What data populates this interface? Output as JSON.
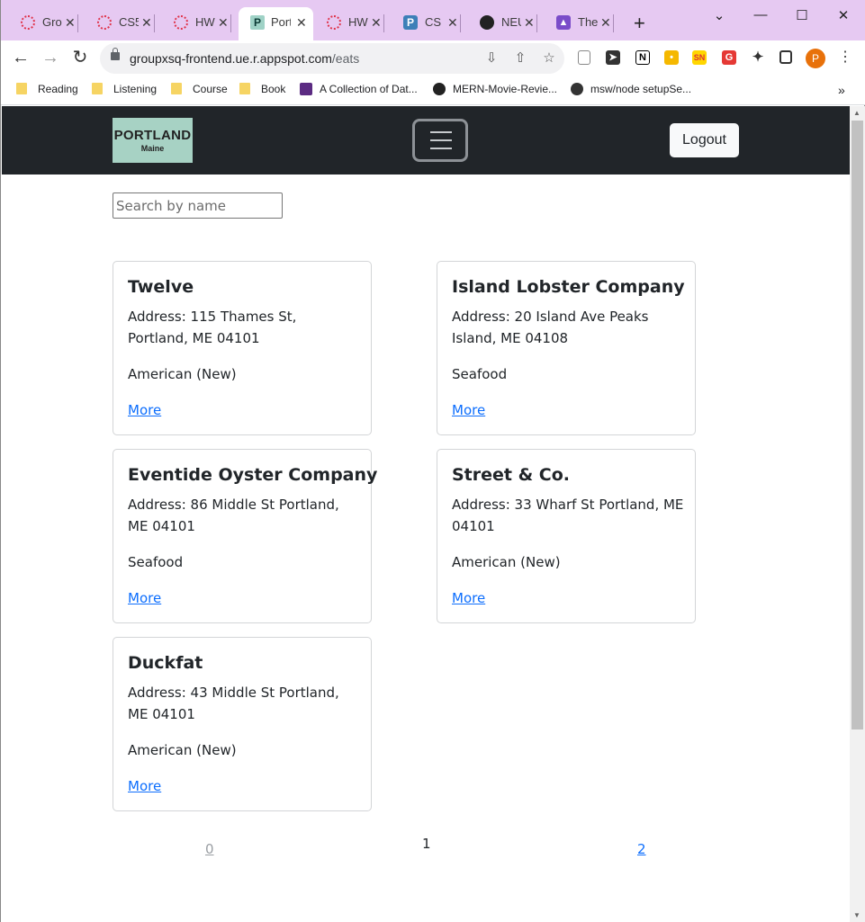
{
  "browser": {
    "tabs": [
      {
        "title": "Gro",
        "icon": "ring-icon"
      },
      {
        "title": "CS5",
        "icon": "ring-icon"
      },
      {
        "title": "HW",
        "icon": "ring-icon"
      },
      {
        "title": "Port",
        "icon": "p-icon",
        "active": true
      },
      {
        "title": "HW",
        "icon": "ring-icon"
      },
      {
        "title": "CS 5",
        "icon": "p-icon"
      },
      {
        "title": "NEU",
        "icon": "github-icon"
      },
      {
        "title": "The",
        "icon": "bell-icon"
      }
    ],
    "url_host": "groupxsq-frontend.ue.r.appspot.com",
    "url_path": "/eats",
    "profile_initial": "P",
    "bookmarks": [
      {
        "label": "Reading",
        "icon": "folder-icon"
      },
      {
        "label": "Listening",
        "icon": "folder-icon"
      },
      {
        "label": "Course",
        "icon": "folder-icon"
      },
      {
        "label": "Book",
        "icon": "folder-icon"
      },
      {
        "label": "A Collection of Dat...",
        "icon": "flag-icon"
      },
      {
        "label": "MERN-Movie-Revie...",
        "icon": "github-icon"
      },
      {
        "label": "msw/node setupSe...",
        "icon": "globe-icon"
      }
    ]
  },
  "site": {
    "logo_main": "PORTLAND",
    "logo_sub": "Maine",
    "logout_label": "Logout",
    "search_placeholder": "Search by name",
    "restaurants": [
      {
        "name": "Twelve",
        "address": "Address: 115 Thames St, Portland, ME 04101",
        "cuisine": "American (New)",
        "more": "More"
      },
      {
        "name": "Island Lobster Company",
        "address": "Address: 20 Island Ave Peaks Island, ME 04108",
        "cuisine": "Seafood",
        "more": "More"
      },
      {
        "name": "Eventide Oyster Company",
        "address": "Address: 86 Middle St Portland, ME 04101",
        "cuisine": "Seafood",
        "more": "More"
      },
      {
        "name": "Street & Co.",
        "address": "Address: 33 Wharf St Portland, ME 04101",
        "cuisine": "American (New)",
        "more": "More"
      },
      {
        "name": "Duckfat",
        "address": "Address: 43 Middle St Portland, ME 04101",
        "cuisine": "American (New)",
        "more": "More"
      }
    ],
    "pagination": {
      "prev": "0",
      "current": "1",
      "next": "2"
    }
  },
  "colors": {
    "navbar": "#212529",
    "logo_bg": "#a7d2c4",
    "link": "#0d6efd",
    "tabstrip": "#e6c9f2"
  }
}
